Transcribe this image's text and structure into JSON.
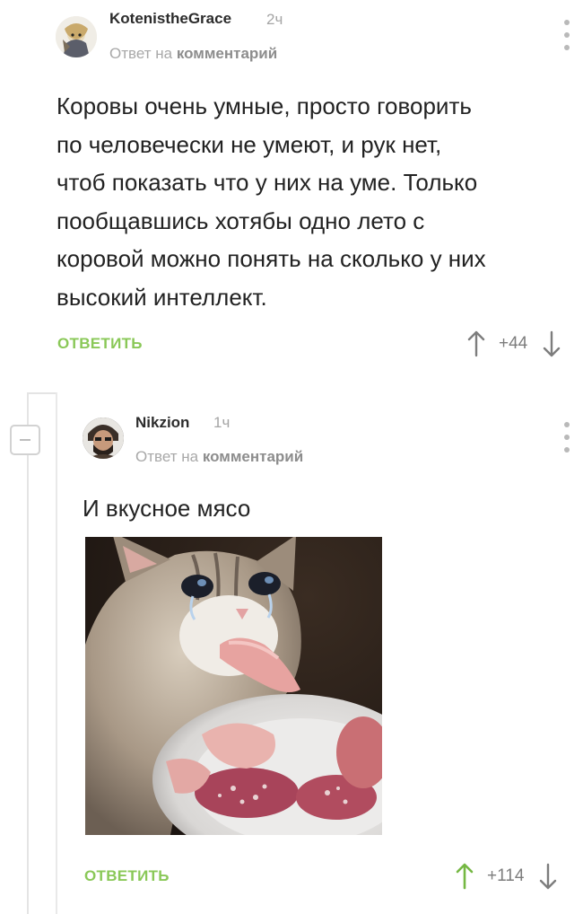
{
  "comments": [
    {
      "author": "KotenistheGrace",
      "time": "2ч",
      "reply_prefix": "Ответ на",
      "reply_target": "комментарий",
      "text_lines": [
        "Коровы очень умные, просто говорить",
        "по человечески не умеют, и рук нет,",
        "чтоб показать что у них на уме. Только",
        "пообщавшись хотябы одно лето с",
        "коровой можно понять на сколько у них",
        "высокий интеллект."
      ],
      "reply_label": "ОТВЕТИТЬ",
      "rating": "+44",
      "vote_up_icon": "arrow-up-icon",
      "vote_down_icon": "arrow-down-icon"
    },
    {
      "author": "Nikzion",
      "time": "1ч",
      "reply_prefix": "Ответ на",
      "reply_target": "комментарий",
      "text": "И вкусное мясо",
      "image_description_icon": "crying-cat-eating-sausage-image",
      "reply_label": "ОТВЕТИТЬ",
      "rating": "+114",
      "vote_up_icon": "arrow-up-icon",
      "vote_down_icon": "arrow-down-icon"
    }
  ],
  "colors": {
    "accent_green": "#8ac858",
    "upvoted_green": "#75b843",
    "muted_gray": "#a5a5a5",
    "text": "#222222"
  }
}
